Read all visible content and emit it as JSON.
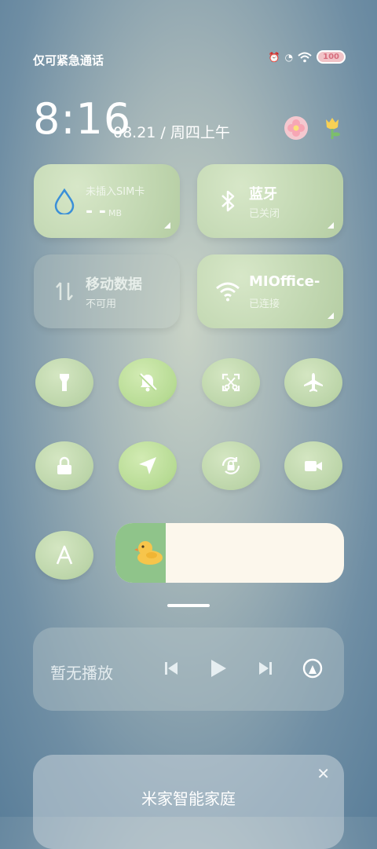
{
  "status_bar": {
    "carrier_text": "仅可紧急通话",
    "battery_level": "100",
    "wifi_icon": "wifi-icon",
    "battery_icon": "battery-icon"
  },
  "clock": {
    "time": "8:16",
    "date": "08.21 / 周四上午"
  },
  "tiles": {
    "sim": {
      "title": "未插入SIM卡",
      "value": "- -",
      "unit": "MB"
    },
    "bluetooth": {
      "title": "蓝牙",
      "status": "已关闭"
    },
    "mobile_data": {
      "title": "移动数据",
      "status": "不可用"
    },
    "wifi": {
      "title": "MIOffice-",
      "status": "已连接"
    }
  },
  "quick_toggles": [
    {
      "name": "flashlight-icon",
      "active": false
    },
    {
      "name": "do-not-disturb-icon",
      "active": true
    },
    {
      "name": "screenshot-icon",
      "active": false
    },
    {
      "name": "airplane-icon",
      "active": false
    },
    {
      "name": "lock-icon",
      "active": false
    },
    {
      "name": "location-icon",
      "active": true
    },
    {
      "name": "auto-rotate-icon",
      "active": false
    },
    {
      "name": "video-icon",
      "active": false
    },
    {
      "name": "auto-brightness-icon",
      "active": false
    }
  ],
  "brightness": {
    "level": 0.22
  },
  "media": {
    "label": "暂无播放",
    "prev_icon": "skip-previous-icon",
    "play_icon": "play-icon",
    "next_icon": "skip-next-icon",
    "cast_icon": "cast-icon"
  },
  "smart_home": {
    "title": "米家智能家庭",
    "close_glyph": "✕"
  },
  "colors": {
    "tile_green": "#c4d9b4",
    "slider_fill": "#8fc48a",
    "slider_track": "#fcf7ec"
  }
}
